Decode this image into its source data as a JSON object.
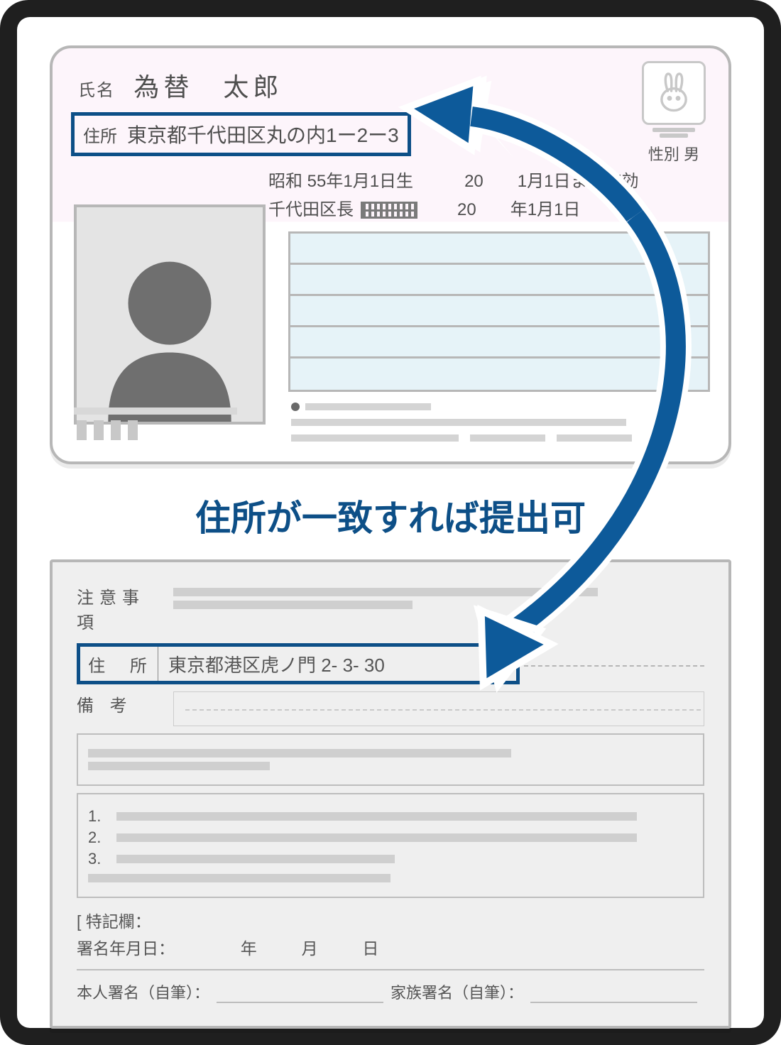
{
  "id_card": {
    "name_label": "氏名",
    "name_value": "為替　太郎",
    "address_label": "住所",
    "address_value": "東京都千代田区丸の内1ー2ー3",
    "birth": "昭和 55年1月1日生",
    "valid_until": "20　　1月1日まで有効",
    "issuer_prefix": "千代田区長",
    "issue_date": "20　　年1月1日",
    "gender_label": "性別",
    "gender_value": "男"
  },
  "caption": "住所が一致すれば提出可",
  "form_card": {
    "notice_label": "注意事項",
    "address_label": "住 所",
    "address_value": "東京都港区虎ノ門 2- 3- 30",
    "remarks_label": "備 考",
    "list_numbers": [
      "1.",
      "2.",
      "3."
    ],
    "special_label": "[ 特記欄：",
    "sign_date_label": "署名年月日：",
    "sign_date_parts": {
      "year": "年",
      "month": "月",
      "day": "日"
    },
    "self_sign_label": "本人署名（自筆）：",
    "family_sign_label": "家族署名（自筆）："
  },
  "colors": {
    "accent": "#0d4f87"
  }
}
